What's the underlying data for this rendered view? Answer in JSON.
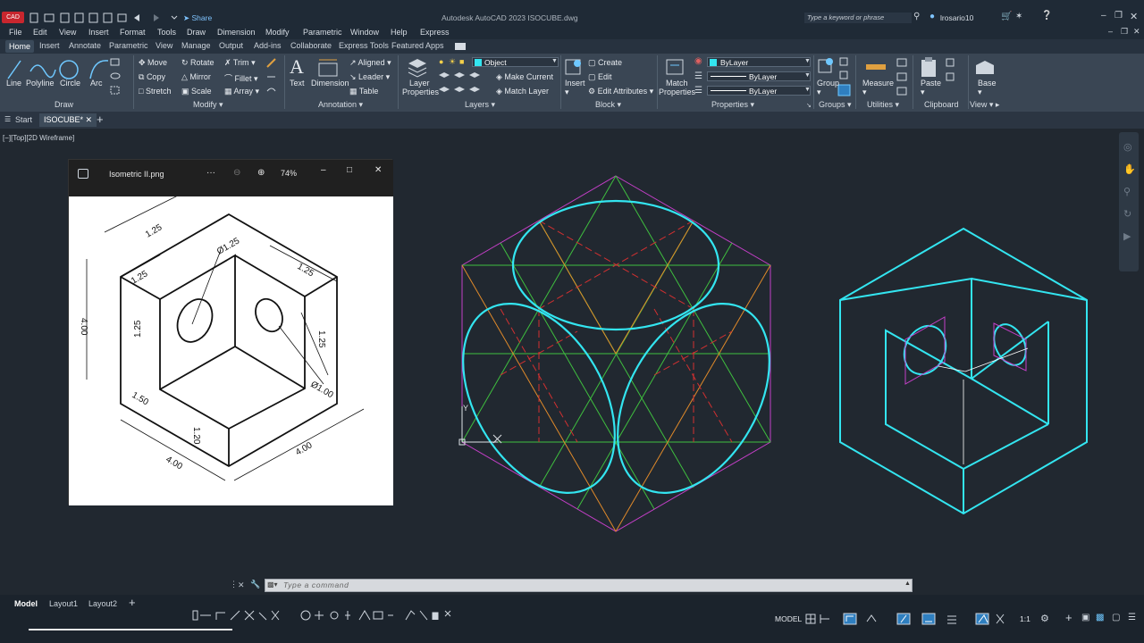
{
  "titlebar": {
    "app_badge": "CAD",
    "share_label": "Share",
    "title": "Autodesk AutoCAD 2023    ISOCUBE.dwg",
    "search_placeholder": "Type a keyword or phrase",
    "user": "lrosario10"
  },
  "menu": [
    "File",
    "Edit",
    "View",
    "Insert",
    "Format",
    "Tools",
    "Draw",
    "Dimension",
    "Modify",
    "Parametric",
    "Window",
    "Help",
    "Express"
  ],
  "ribbon_tabs": [
    "Home",
    "Insert",
    "Annotate",
    "Parametric",
    "View",
    "Manage",
    "Output",
    "Add-ins",
    "Collaborate",
    "Express Tools",
    "Featured Apps"
  ],
  "ribbon": {
    "draw": {
      "line": "Line",
      "polyline": "Polyline",
      "circle": "Circle",
      "arc": "Arc",
      "title": "Draw"
    },
    "modify": {
      "move": "Move",
      "rotate": "Rotate",
      "trim": "Trim",
      "copy": "Copy",
      "mirror": "Mirror",
      "fillet": "Fillet",
      "stretch": "Stretch",
      "scale": "Scale",
      "array": "Array",
      "title": "Modify"
    },
    "annotation": {
      "text": "Text",
      "dimension": "Dimension",
      "aligned": "Aligned",
      "leader": "Leader",
      "table": "Table",
      "title": "Annotation"
    },
    "layers": {
      "layer_properties_1": "Layer",
      "layer_properties_2": "Properties",
      "current_layer": "Object",
      "make_current": "Make Current",
      "match_layer": "Match Layer",
      "title": "Layers"
    },
    "block": {
      "insert": "Insert",
      "create": "Create",
      "edit": "Edit",
      "edit_attributes": "Edit Attributes",
      "title": "Block"
    },
    "properties": {
      "match_1": "Match",
      "match_2": "Properties",
      "color": "ByLayer",
      "linetype": "ByLayer",
      "lineweight": "ByLayer",
      "title": "Properties"
    },
    "groups": {
      "group": "Group",
      "title": "Groups"
    },
    "utilities": {
      "measure": "Measure",
      "title": "Utilities"
    },
    "clipboard": {
      "paste": "Paste",
      "title": "Clipboard"
    },
    "view": {
      "base": "Base",
      "title": "View"
    }
  },
  "doc_tabs": {
    "start": "Start",
    "current": "ISOCUBE*"
  },
  "viewport_label": "[−][Top][2D Wireframe]",
  "viewer": {
    "title": "Isometric II.png",
    "more": "···",
    "zoom": "74%",
    "dims": {
      "d1": "1.25",
      "d2": "Ø1.25",
      "d3": "1.25",
      "d4": "1.25",
      "d5": "1.25",
      "d6": "4.00",
      "d7": "1.25",
      "d8": "1.50",
      "d9": "Ø1.00",
      "d10": "1.20",
      "d11": "4.00",
      "d12": "4.00"
    }
  },
  "ucs": {
    "y": "Y",
    "x": "X"
  },
  "cmdline": {
    "placeholder": "Type a command"
  },
  "status": {
    "tabs": [
      "Model",
      "Layout1",
      "Layout2"
    ],
    "model": "MODEL",
    "scale": "1:1"
  },
  "colors": {
    "cyan": "#33e5f0",
    "magenta": "#c43fc7",
    "green": "#3fbf3f",
    "red": "#d23030",
    "orange": "#e08a2a"
  }
}
